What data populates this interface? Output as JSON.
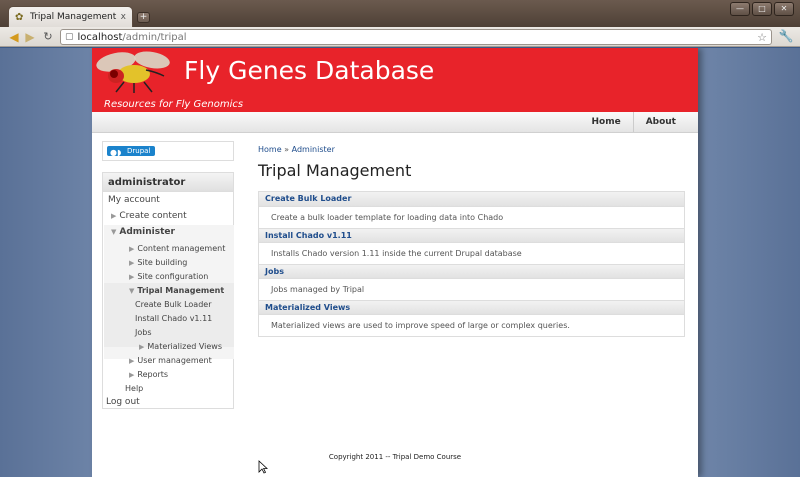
{
  "browser": {
    "tab_title": "Tripal Management | ...",
    "tab_close": "x",
    "new_tab": "+",
    "url_host": "localhost",
    "url_path": "/admin/tripal"
  },
  "site": {
    "name": "Fly Genes Database",
    "slogan": "Resources for Fly Genomics"
  },
  "primary_nav": [
    {
      "label": "Home"
    },
    {
      "label": "About"
    }
  ],
  "drupal_badge": "Drupal",
  "user_menu": {
    "heading": "administrator",
    "my_account": "My account",
    "create_content": "Create content",
    "administer": "Administer",
    "content_management": "Content management",
    "site_building": "Site building",
    "site_configuration": "Site configuration",
    "tripal_management": "Tripal Management",
    "create_bulk_loader": "Create Bulk Loader",
    "install_chado": "Install Chado v1.11",
    "jobs": "Jobs",
    "materialized_views": "Materialized Views",
    "user_management": "User management",
    "reports": "Reports",
    "help": "Help",
    "log_out": "Log out"
  },
  "breadcrumb": {
    "home": "Home",
    "sep": "»",
    "administer": "Administer"
  },
  "page_title": "Tripal Management",
  "admin_items": [
    {
      "title": "Create Bulk Loader",
      "desc": "Create a bulk loader template for loading data into Chado"
    },
    {
      "title": "Install Chado v1.11",
      "desc": "Installs Chado version 1.11 inside the current Drupal database"
    },
    {
      "title": "Jobs",
      "desc": "Jobs managed by Tripal"
    },
    {
      "title": "Materialized Views",
      "desc": "Materialized views are used to improve speed of large or complex queries."
    }
  ],
  "footer": "Copyright 2011 -- Tripal Demo Course",
  "colors": {
    "header_red": "#e8232a",
    "link_blue": "#1f4d8c"
  }
}
